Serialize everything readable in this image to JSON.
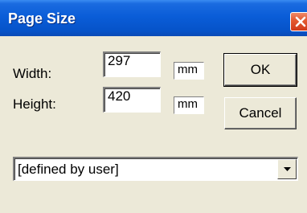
{
  "window": {
    "title": "Page Size"
  },
  "width": {
    "label": "Width:",
    "value": "297",
    "unit": "mm"
  },
  "height": {
    "label": "Height:",
    "value": "420",
    "unit": "mm"
  },
  "buttons": {
    "ok_label": "OK",
    "cancel_label": "Cancel"
  },
  "preset": {
    "selected": "[defined by user]"
  },
  "icons": {
    "close": "close-icon",
    "dropdown": "chevron-down-icon"
  },
  "colors": {
    "titlebar": "#0a5dd8",
    "close_button": "#e45a32",
    "dialog_background": "#ece9d8"
  }
}
